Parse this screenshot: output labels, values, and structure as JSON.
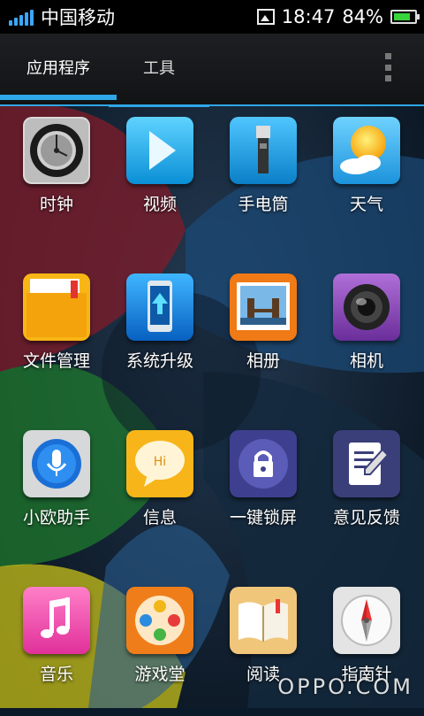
{
  "status_bar": {
    "carrier": "中国移动",
    "time": "18:47",
    "battery_percent": "84%",
    "battery_level": 0.84,
    "signal_bars": 5
  },
  "tabs": [
    {
      "label": "应用程序",
      "selected": true
    },
    {
      "label": "工具",
      "selected": false
    }
  ],
  "apps": [
    {
      "label": "时钟",
      "icon": "clock-icon"
    },
    {
      "label": "视频",
      "icon": "video-play-icon"
    },
    {
      "label": "手电筒",
      "icon": "flashlight-icon"
    },
    {
      "label": "天气",
      "icon": "weather-sun-icon"
    },
    {
      "label": "文件管理",
      "icon": "folder-icon"
    },
    {
      "label": "系统升级",
      "icon": "system-update-icon"
    },
    {
      "label": "相册",
      "icon": "gallery-icon"
    },
    {
      "label": "相机",
      "icon": "camera-icon"
    },
    {
      "label": "小欧助手",
      "icon": "microphone-icon"
    },
    {
      "label": "信息",
      "icon": "message-bubble-icon"
    },
    {
      "label": "一键锁屏",
      "icon": "lock-icon"
    },
    {
      "label": "意见反馈",
      "icon": "feedback-icon"
    },
    {
      "label": "音乐",
      "icon": "music-note-icon"
    },
    {
      "label": "游戏堂",
      "icon": "gamepad-icon"
    },
    {
      "label": "阅读",
      "icon": "book-icon"
    },
    {
      "label": "指南针",
      "icon": "compass-icon"
    }
  ],
  "watermark": "OPPO.COM",
  "colors": {
    "accent": "#2fa6e6",
    "battery": "#38d43a",
    "signal": "#3aa7ff"
  }
}
